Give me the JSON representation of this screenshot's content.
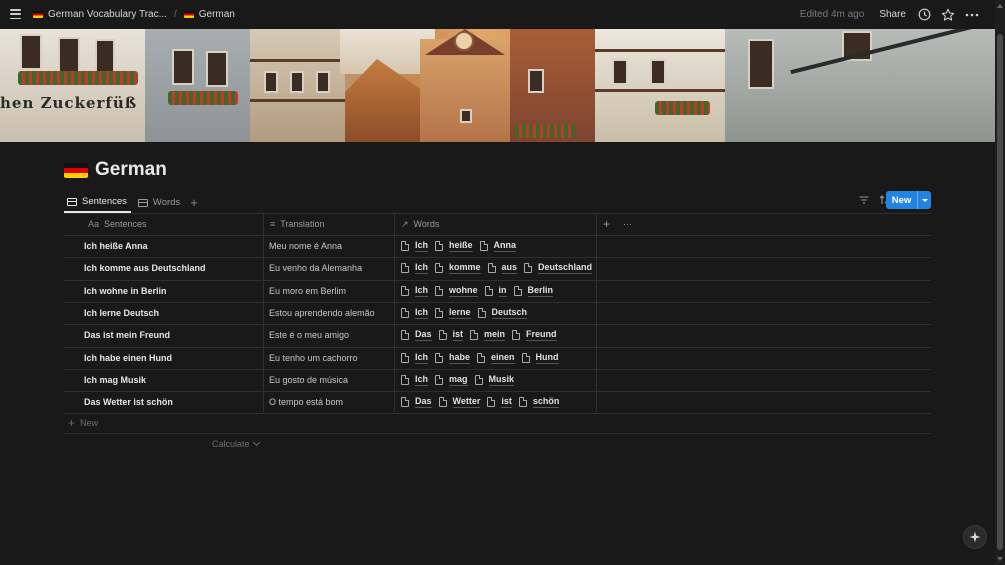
{
  "breadcrumb": {
    "parent": "German Vocabulary Trac...",
    "separator": "/",
    "current": "German"
  },
  "topbar": {
    "edited": "Edited 4m ago",
    "share": "Share"
  },
  "cover": {
    "sign_text": "hen Zuckerfüß"
  },
  "page": {
    "title": "German"
  },
  "views": {
    "tabs": [
      {
        "label": "Sentences",
        "active": true
      },
      {
        "label": "Words",
        "active": false
      }
    ],
    "add": "+"
  },
  "toolbar": {
    "new_label": "New"
  },
  "table": {
    "columns": [
      {
        "label": "Sentences",
        "icon": "Aa"
      },
      {
        "label": "Translation",
        "icon": "≡"
      },
      {
        "label": "Words",
        "icon": "↗"
      }
    ],
    "add_column": "+",
    "more": "···",
    "rows": [
      {
        "sentence": "Ich heiße Anna",
        "translation": "Meu nome é Anna",
        "words": [
          "Ich",
          "heiße",
          "Anna"
        ]
      },
      {
        "sentence": "Ich komme aus Deutschland",
        "translation": "Eu venho da Alemanha",
        "words": [
          "Ich",
          "komme",
          "aus",
          "Deutschland"
        ]
      },
      {
        "sentence": "Ich wohne in Berlin",
        "translation": "Eu moro em Berlim",
        "words": [
          "Ich",
          "wohne",
          "in",
          "Berlin"
        ]
      },
      {
        "sentence": "Ich lerne Deutsch",
        "translation": "Estou aprendendo alemão",
        "words": [
          "Ich",
          "lerne",
          "Deutsch"
        ]
      },
      {
        "sentence": "Das ist mein Freund",
        "translation": "Este é o meu amigo",
        "words": [
          "Das",
          "ist",
          "mein",
          "Freund"
        ]
      },
      {
        "sentence": "Ich habe einen Hund",
        "translation": "Eu tenho um cachorro",
        "words": [
          "Ich",
          "habe",
          "einen",
          "Hund"
        ]
      },
      {
        "sentence": "Ich mag Musik",
        "translation": "Eu gosto de música",
        "words": [
          "Ich",
          "mag",
          "Musik"
        ]
      },
      {
        "sentence": "Das Wetter ist schön",
        "translation": "O tempo está bom",
        "words": [
          "Das",
          "Wetter",
          "ist",
          "schön"
        ]
      }
    ],
    "new_row": "New",
    "calculate": "Calculate"
  },
  "colors": {
    "background": "#191919",
    "accent": "#2383e2",
    "text": "#e6e6e6",
    "muted": "#9b9b9b"
  }
}
